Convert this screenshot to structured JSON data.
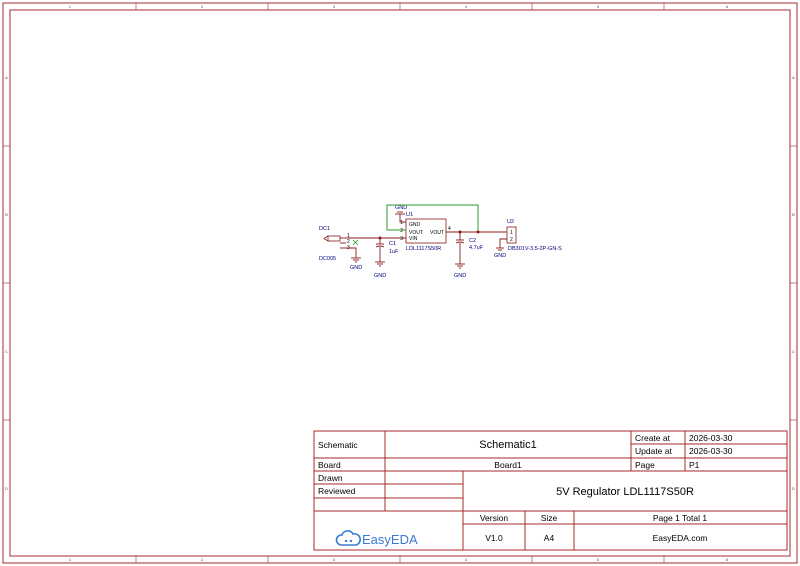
{
  "border": {
    "columns": [
      "1",
      "2",
      "3",
      "4",
      "5",
      "6"
    ],
    "rows": [
      "A",
      "B",
      "C",
      "D"
    ]
  },
  "title_block": {
    "schematic_label": "Schematic",
    "schematic_name": "Schematic1",
    "create_label": "Create at",
    "create_date": "2026-03-30",
    "update_label": "Update at",
    "update_date": "2026-03-30",
    "board_label": "Board",
    "board_name": "Board1",
    "page_label": "Page",
    "page_value": "P1",
    "drawn_label": "Drawn",
    "reviewed_label": "Reviewed",
    "title": "5V Regulator LDL1117S50R",
    "version_label": "Version",
    "size_label": "Size",
    "page_total": "Page  1  Total  1",
    "version_value": "V1.0",
    "size_value": "A4",
    "website": "EasyEDA.com",
    "logo_text": "EasyEDA"
  },
  "schematic": {
    "dc1_ref": "DC1",
    "dc1_value": "DC005",
    "dc1_pin1": "1",
    "dc1_pin2": "2",
    "dc1_pin3": "3",
    "u1_ref": "U1",
    "u1_value": "LDL1117S50R",
    "u1_pin_gnd": "GND",
    "u1_pin_vout": "VOUT",
    "u1_pin_vin": "VIN",
    "u1_pin_vout2": "VOUT",
    "u1_pin1": "1",
    "u1_pin2": "2",
    "u1_pin3": "3",
    "u1_pin4": "4",
    "c1_ref": "C1",
    "c1_value": "1uF",
    "c2_ref": "C2",
    "c2_value": "4.7uF",
    "u2_ref": "U2",
    "u2_value": "DB301V-3.5-2P-GN-S",
    "u2_pin1": "1",
    "u2_pin2": "2",
    "gnd": "GND"
  },
  "colors": {
    "frame": "#a52a2a",
    "wire": "#8b1a1a",
    "gnd_wire": "#2e9b2e",
    "label": "#000080",
    "logo": "#3a7bd5"
  }
}
